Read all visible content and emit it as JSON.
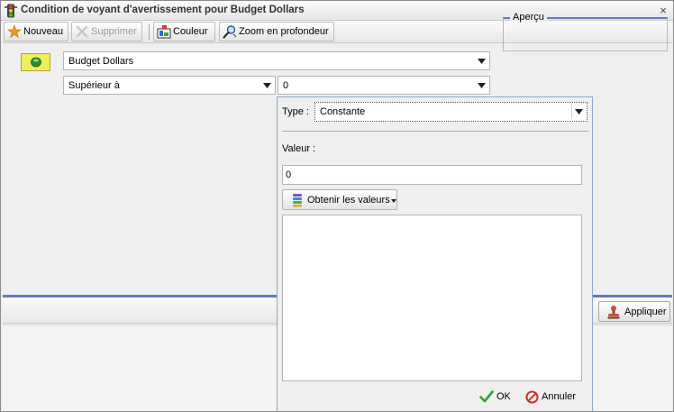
{
  "window": {
    "title": "Condition de voyant d'avertissement pour Budget Dollars",
    "close_symbol": "×"
  },
  "toolbar": {
    "new_label": "Nouveau",
    "delete_label": "Supprimer",
    "color_label": "Couleur",
    "zoom_label": "Zoom en profondeur",
    "icons": [
      "new-star-icon",
      "delete-x-icon",
      "color-palette-icon",
      "zoom-drilldown-icon"
    ]
  },
  "form": {
    "measure_value": "Budget Dollars",
    "operator_value": "Supérieur à",
    "threshold_value": "0",
    "swatch_color": "#f1ee5c",
    "preview_label": "Aperçu"
  },
  "popup": {
    "type_label": "Type :",
    "type_value": "Constante",
    "value_label": "Valeur :",
    "value_input": "0",
    "get_values_label": "Obtenir les valeurs",
    "ok_label": "OK",
    "cancel_label": "Annuler"
  },
  "footer": {
    "apply_label": "Appliquer"
  },
  "colors": {
    "accent_blue": "#5b7ebf",
    "window_bg": "#efefef"
  }
}
